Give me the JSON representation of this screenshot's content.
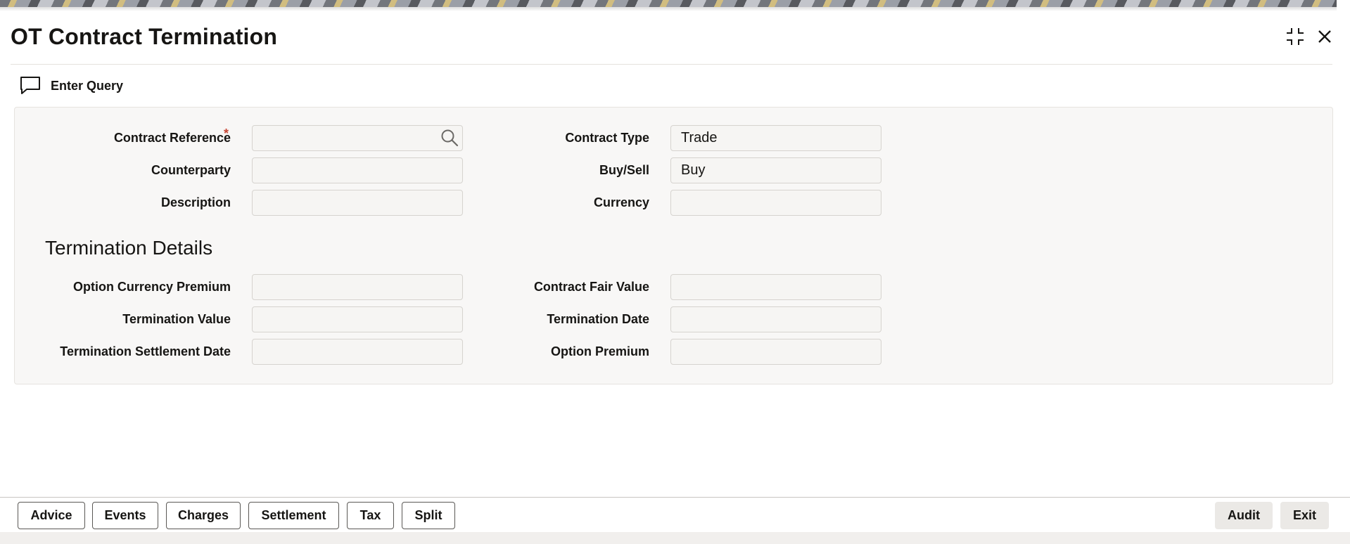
{
  "window": {
    "title": "OT Contract Termination",
    "maximize_icon": "compress-icon",
    "close_icon": "close-icon"
  },
  "toolbar": {
    "enter_query_label": "Enter Query",
    "enter_query_icon": "chat-bubble-icon"
  },
  "form": {
    "contract_reference": {
      "label": "Contract Reference",
      "required_mark": "*",
      "value": ""
    },
    "counterparty": {
      "label": "Counterparty",
      "value": ""
    },
    "description": {
      "label": "Description",
      "value": ""
    },
    "contract_type": {
      "label": "Contract Type",
      "value": "Trade"
    },
    "buy_sell": {
      "label": "Buy/Sell",
      "value": "Buy"
    },
    "currency": {
      "label": "Currency",
      "value": ""
    }
  },
  "termination": {
    "section_title": "Termination Details",
    "option_currency_premium": {
      "label": "Option Currency Premium",
      "value": ""
    },
    "termination_value": {
      "label": "Termination Value",
      "value": ""
    },
    "termination_settlement_date": {
      "label": "Termination Settlement Date",
      "value": ""
    },
    "contract_fair_value": {
      "label": "Contract Fair Value",
      "value": ""
    },
    "termination_date": {
      "label": "Termination Date",
      "value": ""
    },
    "option_premium": {
      "label": "Option Premium",
      "value": ""
    }
  },
  "footer": {
    "advice": "Advice",
    "events": "Events",
    "charges": "Charges",
    "settlement": "Settlement",
    "tax": "Tax",
    "split": "Split",
    "audit": "Audit",
    "exit": "Exit"
  },
  "colors": {
    "required": "#c74634",
    "panel_bg": "#f8f7f6",
    "text": "#161513"
  }
}
